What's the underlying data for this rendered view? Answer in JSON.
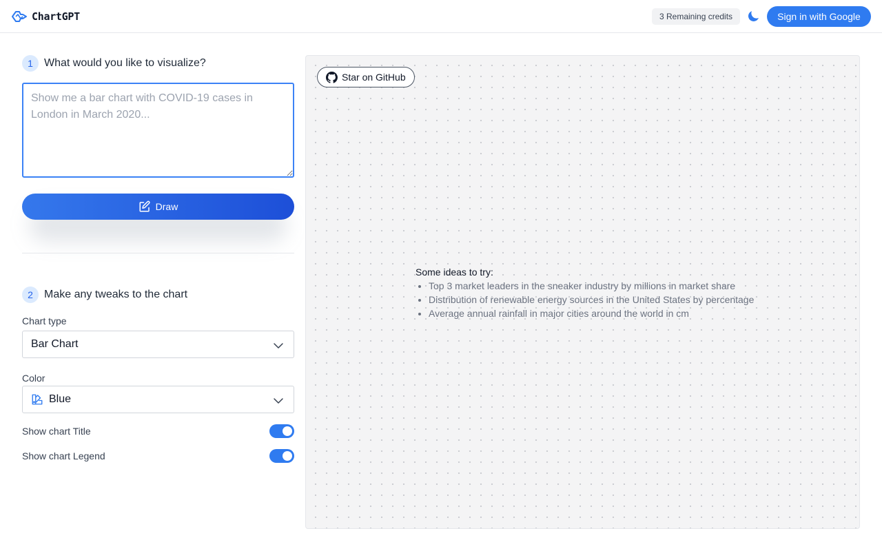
{
  "header": {
    "app_name": "ChartGPT",
    "credits_label": "3 Remaining credits",
    "signin_label": "Sign in with Google"
  },
  "step1": {
    "number": "1",
    "label": "What would you like to visualize?",
    "prompt_placeholder": "Show me a bar chart with COVID-19 cases in London in March 2020...",
    "prompt_value": "",
    "draw_label": "Draw"
  },
  "step2": {
    "number": "2",
    "label": "Make any tweaks to the chart",
    "chart_type_label": "Chart type",
    "chart_type_value": "Bar Chart",
    "color_label": "Color",
    "color_value": "Blue",
    "show_title_label": "Show chart Title",
    "show_title_on": true,
    "show_legend_label": "Show chart Legend",
    "show_legend_on": true
  },
  "canvas": {
    "github_label": "Star on GitHub",
    "ideas_title": "Some ideas to try:",
    "ideas": [
      "Top 3 market leaders in the sneaker industry by millions in market share",
      "Distribution of renewable energy sources in the United States by percentage",
      "Average annual rainfall in major cities around the world in cm"
    ]
  },
  "colors": {
    "accent": "#2f7bf0",
    "draw_gradient_start": "#3578ec",
    "draw_gradient_end": "#1d4fd8",
    "step_badge_bg": "#dbeafe"
  }
}
